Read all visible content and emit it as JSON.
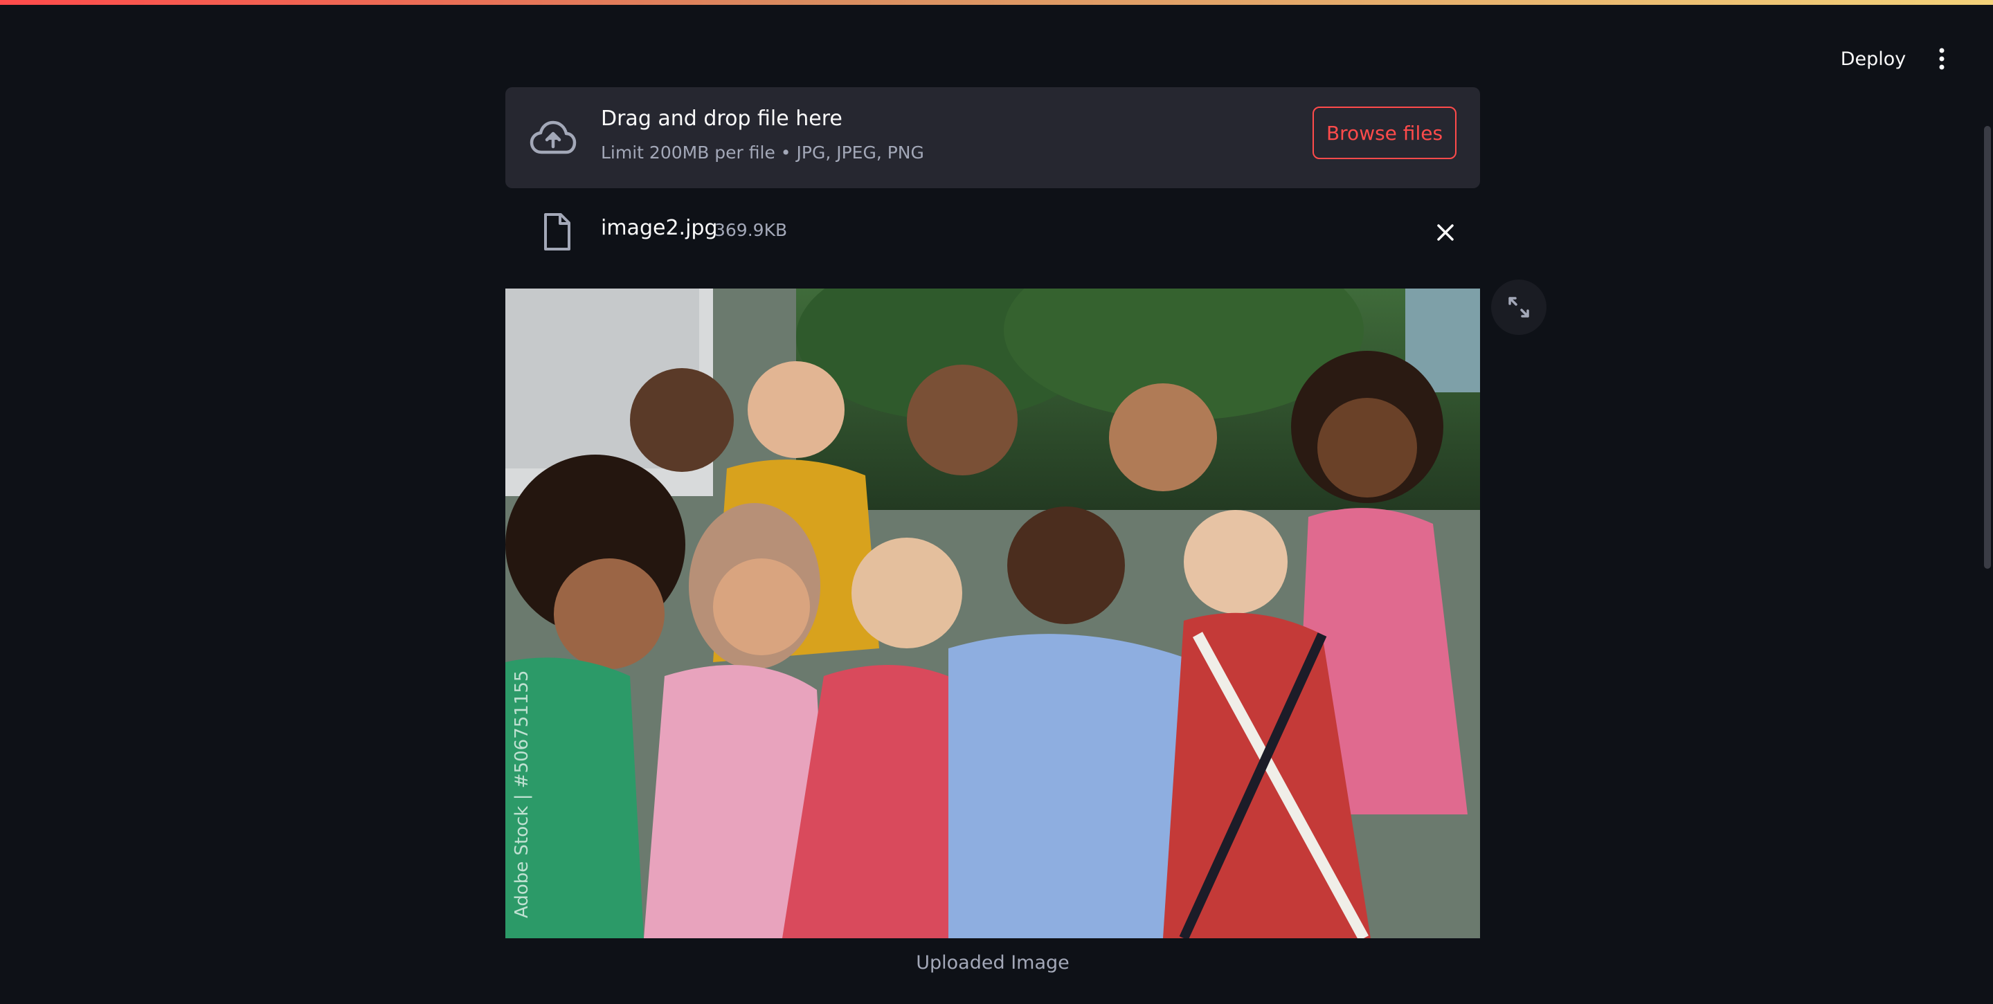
{
  "header": {
    "deploy_label": "Deploy",
    "menu_icon": "more-vertical-icon"
  },
  "uploader": {
    "title": "Drag and drop file here",
    "subtitle": "Limit 200MB per file • JPG, JPEG, PNG",
    "browse_label": "Browse files",
    "icon": "cloud-upload-icon"
  },
  "file": {
    "name": "image2.jpg",
    "size": "369.9KB",
    "icon": "file-icon",
    "remove_icon": "close-icon"
  },
  "image": {
    "caption": "Uploaded Image",
    "watermark": "Adobe Stock | #506751155",
    "expand_icon": "fullscreen-icon"
  },
  "colors": {
    "background": "#0e1117",
    "surface": "#262730",
    "accent": "#ff4b4b",
    "text": "#fafafa",
    "muted_text": "#a3a8b8"
  }
}
